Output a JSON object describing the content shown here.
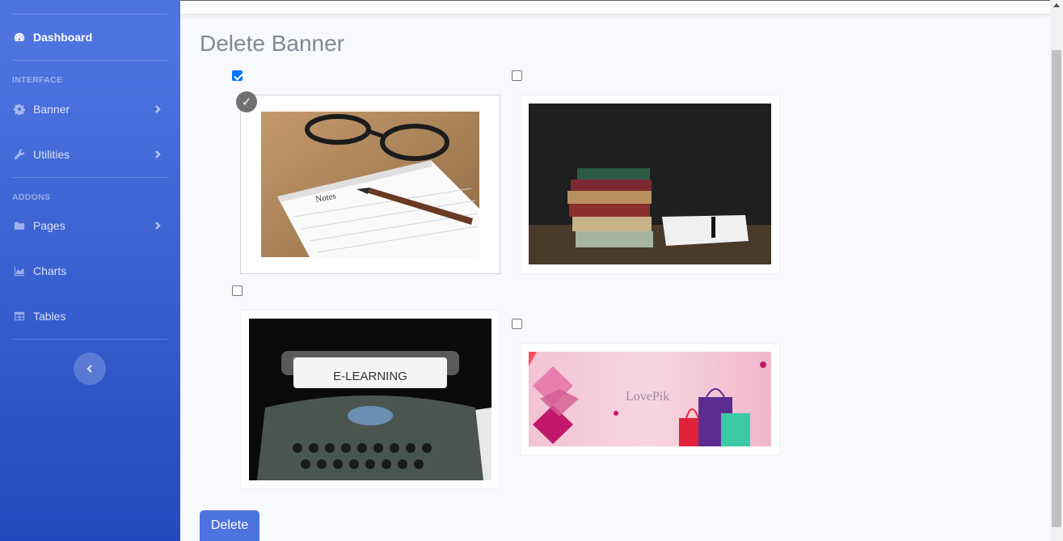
{
  "sidebar": {
    "dashboard_label": "Dashboard",
    "heading_interface": "INTERFACE",
    "heading_addons": "ADDONS",
    "items": [
      {
        "label": "Banner",
        "icon": "gear-icon"
      },
      {
        "label": "Utilities",
        "icon": "wrench-icon"
      },
      {
        "label": "Pages",
        "icon": "folder-icon"
      },
      {
        "label": "Charts",
        "icon": "area-chart-icon"
      },
      {
        "label": "Tables",
        "icon": "table-icon"
      }
    ]
  },
  "main": {
    "title": "Delete Banner",
    "banners": [
      {
        "checked": true,
        "description": "notebook with fountain pen and glasses",
        "image_text": "Notes"
      },
      {
        "checked": false,
        "description": "stack of old books with notepad"
      },
      {
        "checked": false,
        "description": "typewriter with paper",
        "image_text": "E-LEARNING"
      },
      {
        "checked": false,
        "description": "pink shopping banner with bags",
        "image_text": "LovePik"
      }
    ],
    "delete_label": "Delete"
  },
  "colors": {
    "primary": "#4e73df",
    "sidebar_dark": "#224abe",
    "title_gray": "#858796",
    "checkbox_blue": "#0075ff"
  }
}
